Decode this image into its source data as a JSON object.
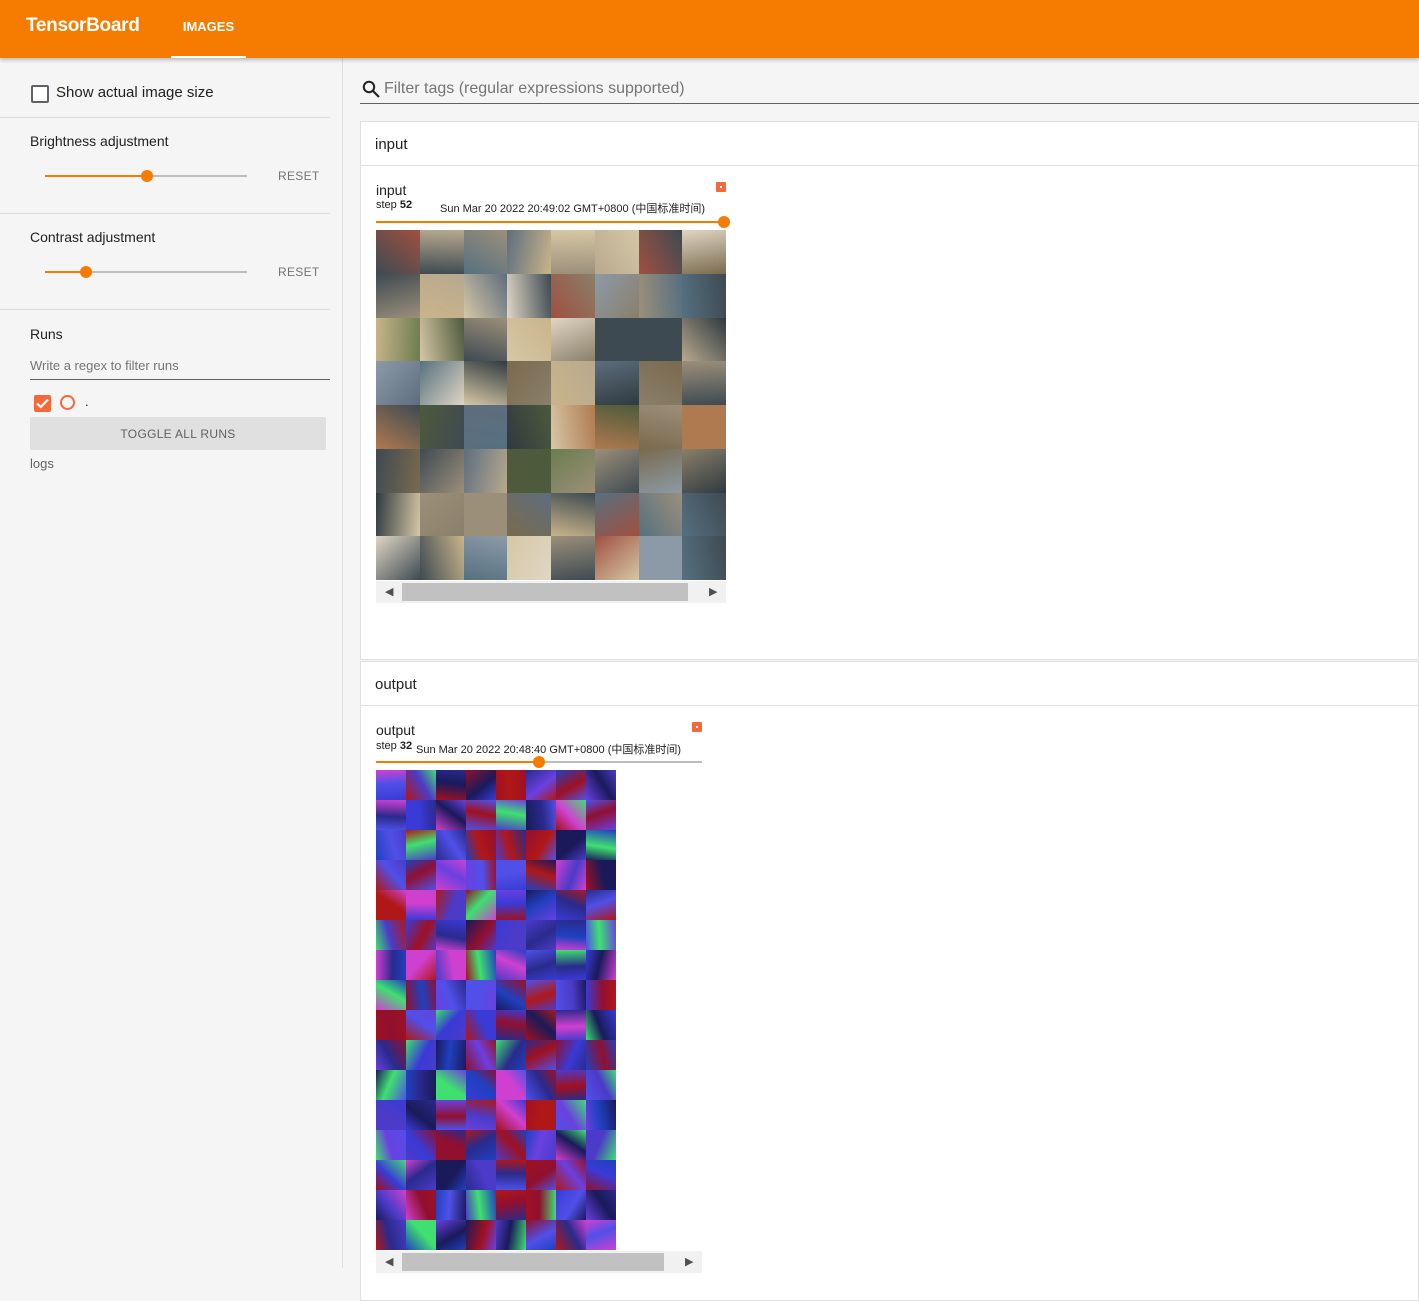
{
  "header": {
    "brand": "TensorBoard",
    "tab_images": "IMAGES",
    "accent": "#f57c00"
  },
  "sidebar": {
    "show_actual_size": {
      "label": "Show actual image size",
      "checked": false
    },
    "brightness": {
      "label": "Brightness adjustment",
      "reset": "RESET",
      "value": 0.5
    },
    "contrast": {
      "label": "Contrast adjustment",
      "reset": "RESET",
      "value": 0.2
    },
    "runs": {
      "title": "Runs",
      "filter_placeholder": "Write a regex to filter runs",
      "run_name": ".",
      "run_color": "#f4683c",
      "toggle_label": "TOGGLE ALL RUNS",
      "logdir": "logs"
    }
  },
  "search": {
    "placeholder": "Filter tags (regular expressions supported)"
  },
  "cards": [
    {
      "group_title": "input",
      "image_title": "input",
      "step_prefix": "step",
      "step": "52",
      "timestamp": "Sun Mar 20 2022 20:49:02 GMT+0800 (中国标准时间)"
    },
    {
      "group_title": "output",
      "image_title": "output",
      "step_prefix": "step",
      "step": "32",
      "timestamp": "Sun Mar 20 2022 20:48:40 GMT+0800 (中国标准时间)"
    }
  ]
}
